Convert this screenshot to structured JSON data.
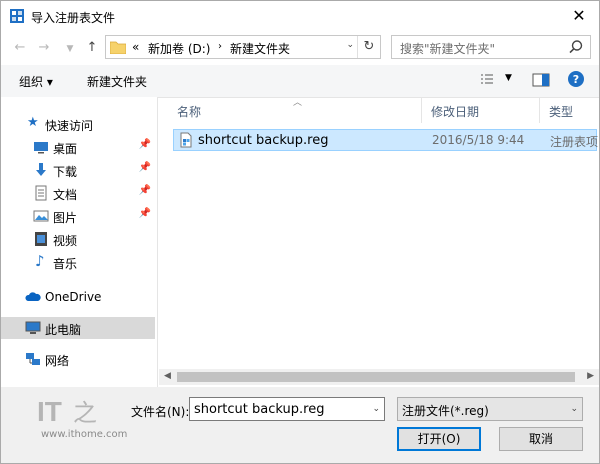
{
  "window": {
    "title": "导入注册表文件"
  },
  "address": {
    "overflow": "«",
    "crumbs": [
      "新加卷 (D:)",
      "新建文件夹"
    ]
  },
  "search": {
    "placeholder": "搜索\"新建文件夹\""
  },
  "toolbar": {
    "organize": "组织 ▾",
    "new_folder": "新建文件夹"
  },
  "nav": {
    "quick_access": "快速访问",
    "items": [
      {
        "label": "桌面",
        "icon": "desktop-icon"
      },
      {
        "label": "下载",
        "icon": "download-icon"
      },
      {
        "label": "文档",
        "icon": "document-icon"
      },
      {
        "label": "图片",
        "icon": "pictures-icon"
      },
      {
        "label": "视频",
        "icon": "video-icon"
      },
      {
        "label": "音乐",
        "icon": "music-icon"
      }
    ],
    "onedrive": "OneDrive",
    "this_pc": "此电脑",
    "network": "网络"
  },
  "columns": {
    "name": "名称",
    "date": "修改日期",
    "type": "类型"
  },
  "files": [
    {
      "name": "shortcut backup.reg",
      "date": "2016/5/18 9:44",
      "type": "注册表项"
    }
  ],
  "bottom": {
    "filename_label": "文件名(N):",
    "filename_value": "shortcut backup.reg",
    "filter_value": "注册文件(*.reg)",
    "open_label": "打开(O)",
    "cancel_label": "取消"
  },
  "watermark": {
    "logo_text": "IT之家",
    "url": "www.ithome.com"
  },
  "colors": {
    "accent": "#0078d7",
    "selection": "#cce8ff",
    "selection_border": "#99d1ff"
  }
}
